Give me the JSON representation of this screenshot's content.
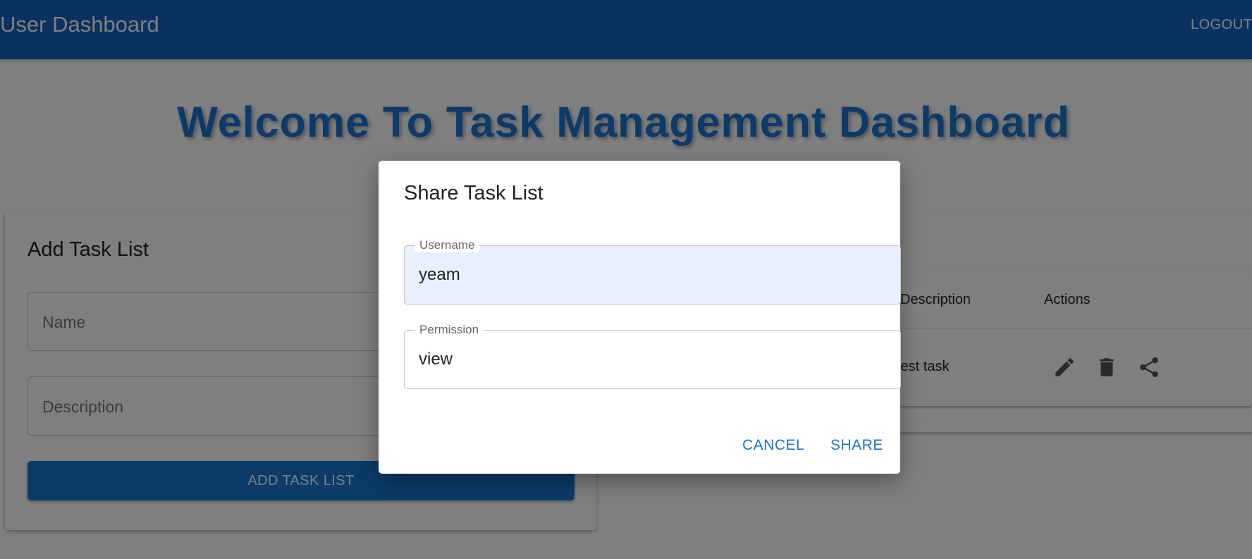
{
  "appbar": {
    "title": "User Dashboard",
    "logout_label": "LOGOUT"
  },
  "welcome_heading": "Welcome To Task Management Dashboard",
  "add_task_card": {
    "title": "Add Task List",
    "name_placeholder": "Name",
    "description_placeholder": "Description",
    "submit_label": "ADD TASK LIST"
  },
  "task_table": {
    "columns": [
      "Description",
      "Actions"
    ],
    "rows": [
      {
        "description": "test task",
        "actions": [
          "edit-icon",
          "delete-icon",
          "share-icon"
        ]
      }
    ]
  },
  "share_dialog": {
    "title": "Share Task List",
    "username_label": "Username",
    "username_value": "yeam",
    "permission_label": "Permission",
    "permission_value": "view",
    "cancel_label": "CANCEL",
    "share_label": "SHARE"
  },
  "colors": {
    "primary": "#1976d2",
    "appbar": "#1565c0",
    "backdrop": "rgba(0,0,0,0.5)",
    "autofill": "#e8f0fe"
  }
}
